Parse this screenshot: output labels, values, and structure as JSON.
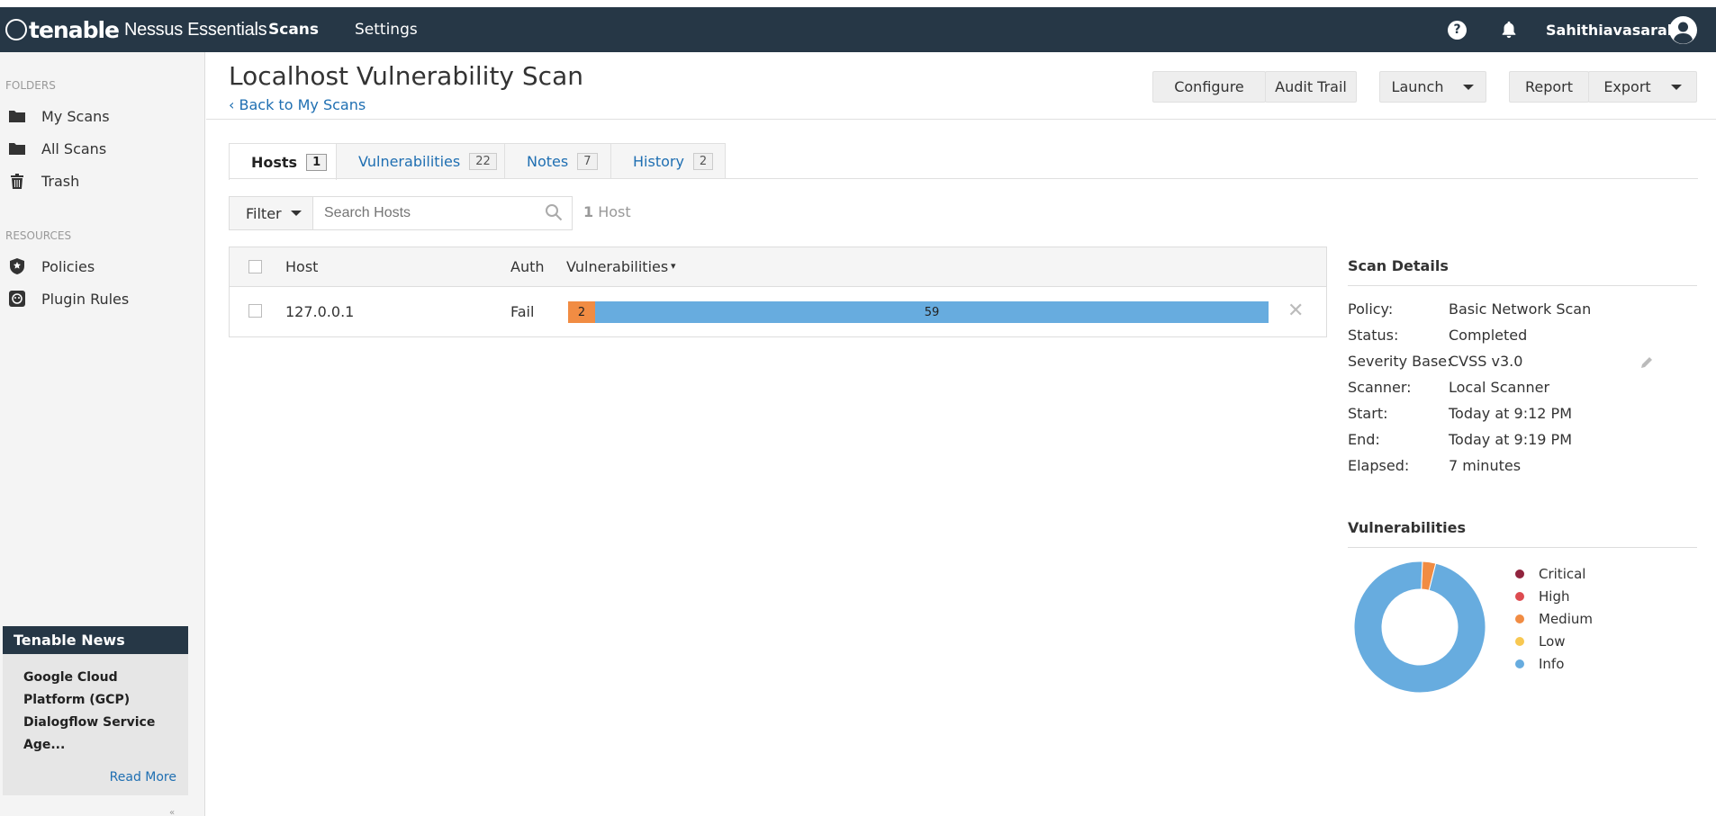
{
  "navbar": {
    "brand": "tenable",
    "product": "Nessus Essentials",
    "links": [
      {
        "label": "Scans"
      },
      {
        "label": "Settings"
      }
    ],
    "help_icon": "question-circle-icon",
    "help_glyph": "?",
    "bell_icon": "bell-icon",
    "username": "Sahithiavasarala",
    "avatar_icon": "user-avatar-icon"
  },
  "sidebar": {
    "folders_heading": "FOLDERS",
    "folders": [
      {
        "label": "My Scans",
        "icon": "folder-icon"
      },
      {
        "label": "All Scans",
        "icon": "folder-icon"
      },
      {
        "label": "Trash",
        "icon": "trash-icon"
      }
    ],
    "resources_heading": "RESOURCES",
    "resources": [
      {
        "label": "Policies",
        "icon": "shield-icon"
      },
      {
        "label": "Plugin Rules",
        "icon": "plugin-rules-icon"
      }
    ],
    "news": {
      "title": "Tenable News",
      "headline": "Google Cloud Platform (GCP) Dialogflow Service Age...",
      "read_more": "Read More"
    },
    "collapse_glyph": "«"
  },
  "page": {
    "title": "Localhost Vulnerability Scan",
    "back_link": "Back to My Scans",
    "back_glyph": "‹"
  },
  "toolbar": {
    "configure": "Configure",
    "audit_trail": "Audit Trail",
    "launch": "Launch",
    "report": "Report",
    "export": "Export"
  },
  "tabs": [
    {
      "label": "Hosts",
      "count": "1",
      "active": true
    },
    {
      "label": "Vulnerabilities",
      "count": "22",
      "active": false
    },
    {
      "label": "Notes",
      "count": "7",
      "active": false
    },
    {
      "label": "History",
      "count": "2",
      "active": false
    }
  ],
  "filter": {
    "label": "Filter",
    "search_placeholder": "Search Hosts",
    "count_number": "1",
    "count_label": " Host"
  },
  "table": {
    "headers": {
      "host": "Host",
      "auth": "Auth",
      "vulnerabilities": "Vulnerabilities",
      "sort_glyph": "▾"
    },
    "rows": [
      {
        "host": "127.0.0.1",
        "auth": "Fail",
        "severity_counts": {
          "critical": 0,
          "high": 0,
          "medium": 2,
          "low": 0,
          "info": 59
        },
        "bar_labels": {
          "medium": "2",
          "info": "59"
        },
        "remove_glyph": "✕"
      }
    ]
  },
  "scan_details": {
    "title": "Scan Details",
    "rows": [
      {
        "label": "Policy:",
        "value": "Basic Network Scan"
      },
      {
        "label": "Status:",
        "value": "Completed"
      },
      {
        "label": "Severity Base:",
        "value": "CVSS v3.0"
      },
      {
        "label": "Scanner:",
        "value": "Local Scanner"
      },
      {
        "label": "Start:",
        "value": "Today at 9:12 PM"
      },
      {
        "label": "End:",
        "value": "Today at 9:19 PM"
      },
      {
        "label": "Elapsed:",
        "value": "7 minutes"
      }
    ],
    "edit_icon": "pencil-icon"
  },
  "vuln_chart": {
    "title": "Vulnerabilities",
    "legend": [
      {
        "label": "Critical",
        "color": "#91243e"
      },
      {
        "label": "High",
        "color": "#dd4b50"
      },
      {
        "label": "Medium",
        "color": "#f18c43"
      },
      {
        "label": "Low",
        "color": "#f8c851"
      },
      {
        "label": "Info",
        "color": "#67acdf"
      }
    ]
  },
  "chart_data": {
    "type": "pie",
    "categories": [
      "Critical",
      "High",
      "Medium",
      "Low",
      "Info"
    ],
    "values": [
      0,
      0,
      2,
      0,
      59
    ],
    "colors": [
      "#91243e",
      "#dd4b50",
      "#f18c43",
      "#f8c851",
      "#67acdf"
    ],
    "title": "Vulnerabilities",
    "legend": "right"
  },
  "colors": {
    "navbar_bg": "#263746",
    "link": "#1f6fb2",
    "medium": "#f18c43",
    "info": "#67acdf"
  }
}
